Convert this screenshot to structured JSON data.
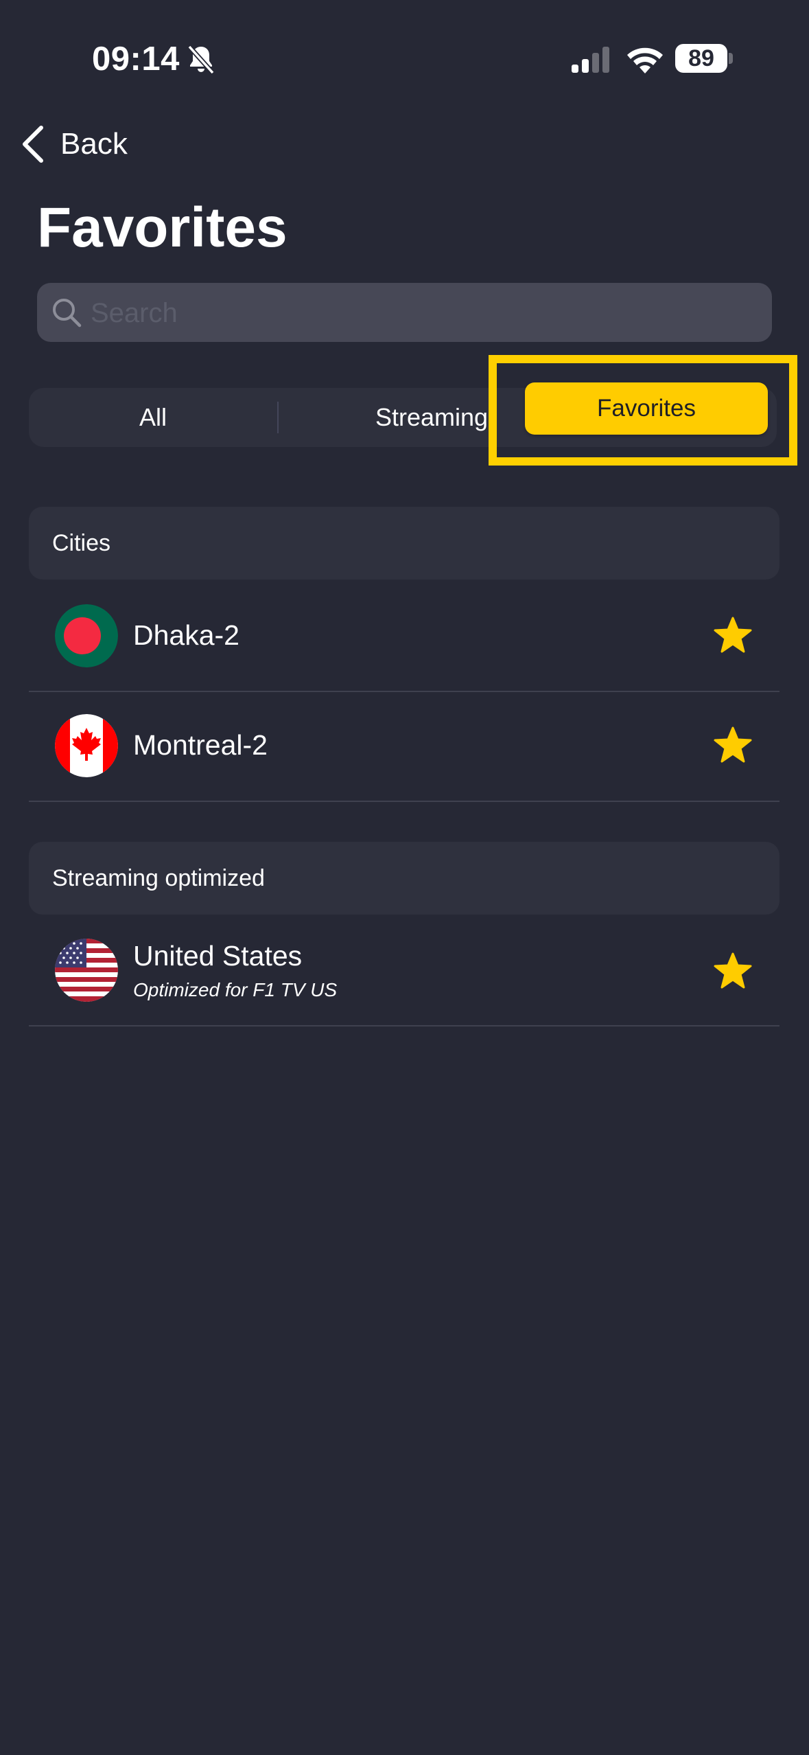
{
  "status_bar": {
    "time": "09:14",
    "battery": "89",
    "icons": [
      "bell-slash-icon",
      "signal-icon",
      "wifi-icon",
      "battery-icon"
    ]
  },
  "nav": {
    "back_label": "Back",
    "back_icon": "chevron-left-icon"
  },
  "page": {
    "title": "Favorites"
  },
  "search": {
    "placeholder": "Search",
    "value": "",
    "icon": "search-icon"
  },
  "tabs": [
    {
      "label": "All",
      "selected": false
    },
    {
      "label": "Streaming",
      "selected": false
    },
    {
      "label": "Favorites",
      "selected": true
    }
  ],
  "sections": [
    {
      "header": "Cities",
      "items": [
        {
          "title": "Dhaka-2",
          "flag": "bangladesh-flag-icon",
          "favorite": true
        },
        {
          "title": "Montreal-2",
          "flag": "canada-flag-icon",
          "favorite": true
        }
      ]
    },
    {
      "header": "Streaming optimized",
      "items": [
        {
          "title": "United States",
          "subtitle": "Optimized for F1 TV US",
          "flag": "usa-flag-icon",
          "favorite": true
        }
      ]
    }
  ],
  "colors": {
    "background": "#262835",
    "accent": "#ffcc00",
    "section_header_bg": "#2f313e",
    "search_bg": "#474856"
  }
}
